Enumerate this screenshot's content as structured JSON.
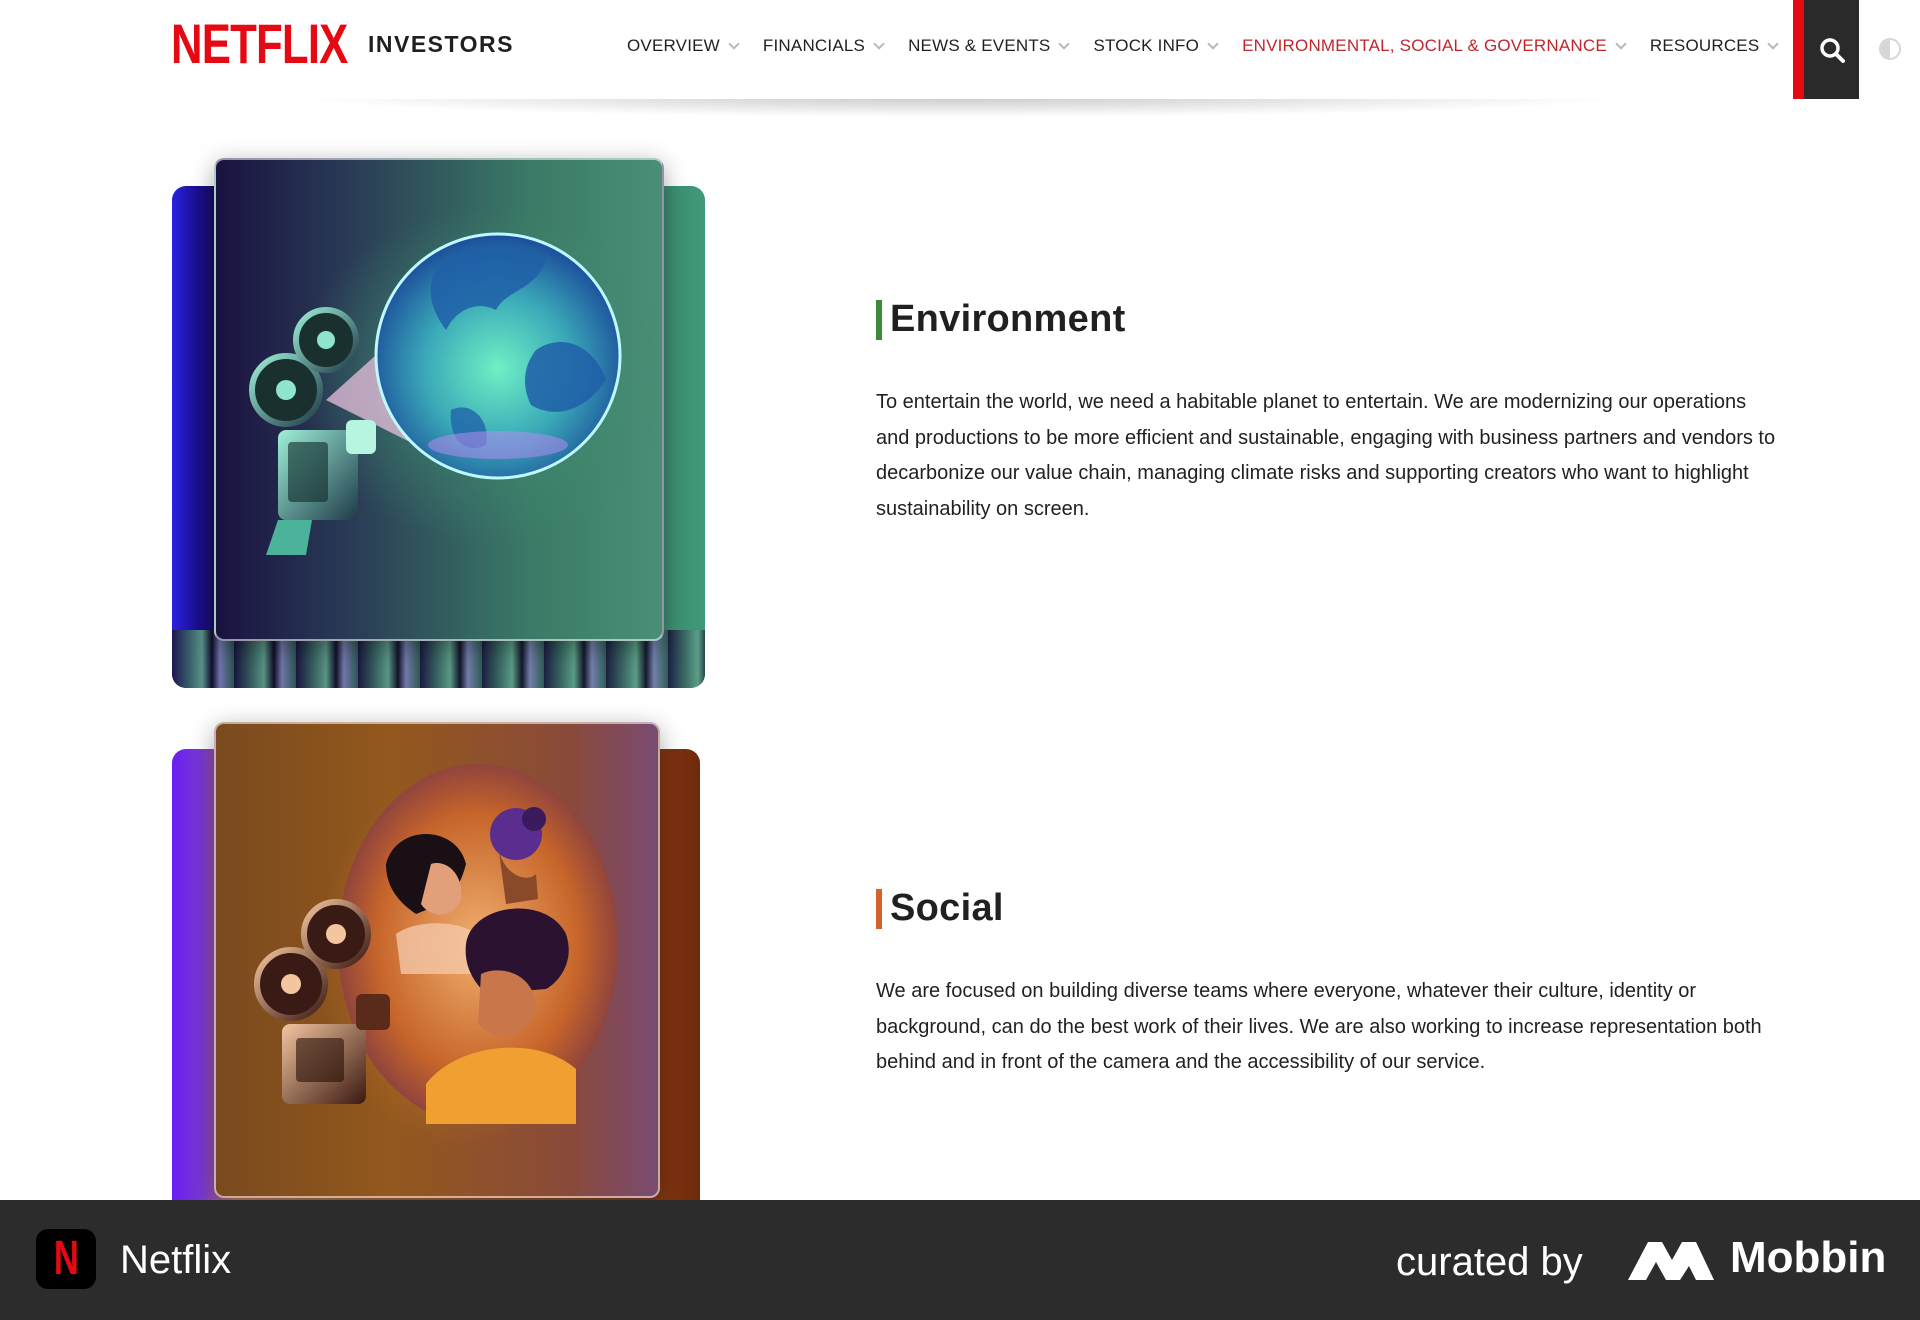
{
  "header": {
    "logo": "NETFLIX",
    "logo_sub": "INVESTORS",
    "nav": [
      {
        "label": "OVERVIEW"
      },
      {
        "label": "FINANCIALS"
      },
      {
        "label": "NEWS & EVENTS"
      },
      {
        "label": "STOCK INFO"
      },
      {
        "label": "ENVIRONMENTAL, SOCIAL & GOVERNANCE",
        "active": true
      },
      {
        "label": "RESOURCES"
      }
    ],
    "search_icon": "search-icon",
    "contrast_icon": "contrast-toggle-icon"
  },
  "sections": [
    {
      "heading": "Environment",
      "accent_color": "#3c8a3a",
      "text": "To entertain the world, we need a habitable planet to entertain. We are modernizing our operations and productions to be more efficient and sustainable, engaging with business partners and vendors to decarbonize our value chain, managing climate risks and supporting creators who want to highlight sustainability on screen.",
      "illustration": "film-projector-globe-illustration"
    },
    {
      "heading": "Social",
      "accent_color": "#d2632a",
      "text": "We are focused on building diverse teams where everyone, whatever their culture, identity or background, can do the best work of their lives. We are also working to increase representation both behind and in front of the camera and the accessibility of our service.",
      "illustration": "film-projector-people-illustration"
    }
  ],
  "footer": {
    "app_icon_letter": "N",
    "app_name": "Netflix",
    "curated_by": "curated by",
    "brand": "Mobbin"
  },
  "colors": {
    "netflix_red": "#e50914",
    "active_nav": "#c1262e",
    "footer_bg": "#2c2c2c"
  }
}
